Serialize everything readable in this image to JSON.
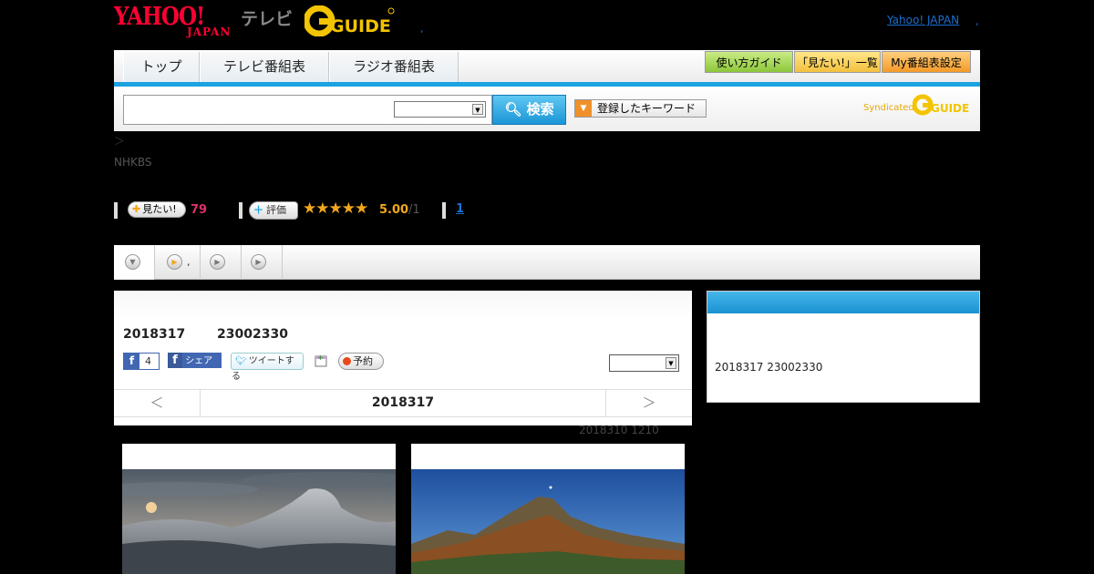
{
  "header": {
    "yahoo_logo_main": "YAHOO!",
    "yahoo_logo_sub": "JAPAN",
    "tv_label": "テレビ",
    "gguide_logo": "G GUIDE",
    "comma": ",",
    "yahoo_japan_link": "Yahoo! JAPAN",
    "link_comma": ","
  },
  "nav": {
    "tabs": [
      "トップ",
      "テレビ番組表",
      "ラジオ番組表"
    ],
    "buttons": [
      "使い方ガイド",
      "「見たい!」一覧",
      "My番組表設定"
    ],
    "button_colors": [
      "#9fd44a",
      "#f6cc50",
      "#f5a23a"
    ]
  },
  "search": {
    "input_value": "",
    "select_value": "",
    "button_label": "検索",
    "keyword_button_label": "登録したキーワード",
    "syndicated_label": "Syndicated"
  },
  "breadcrumb": "＞",
  "channel": "NHKBS",
  "rating": {
    "want_label": "見たい!",
    "want_count": "79",
    "rate_label": "評価",
    "stars": "★★★★★",
    "score": "5.00",
    "count": "/1",
    "review_link": "1"
  },
  "tabs": [
    "",
    ",",
    "",
    ""
  ],
  "program": {
    "date": "2018317",
    "time": "23002330",
    "fb_like_count": "4",
    "fb_share_label": "シェア",
    "tweet_label": "ツイートする",
    "reserve_label": "予約",
    "select_value": "",
    "date_nav": {
      "prev": "＜",
      "current": "2018317",
      "next": "＞"
    },
    "broadcast_note": "2018310  1210"
  },
  "side": {
    "text": "2018317  23002330"
  },
  "colors": {
    "accent_blue": "#1aa3e0",
    "yahoo_red": "#ff0033",
    "star_orange": "#f1a71b",
    "want_pink": "#e0306a"
  }
}
